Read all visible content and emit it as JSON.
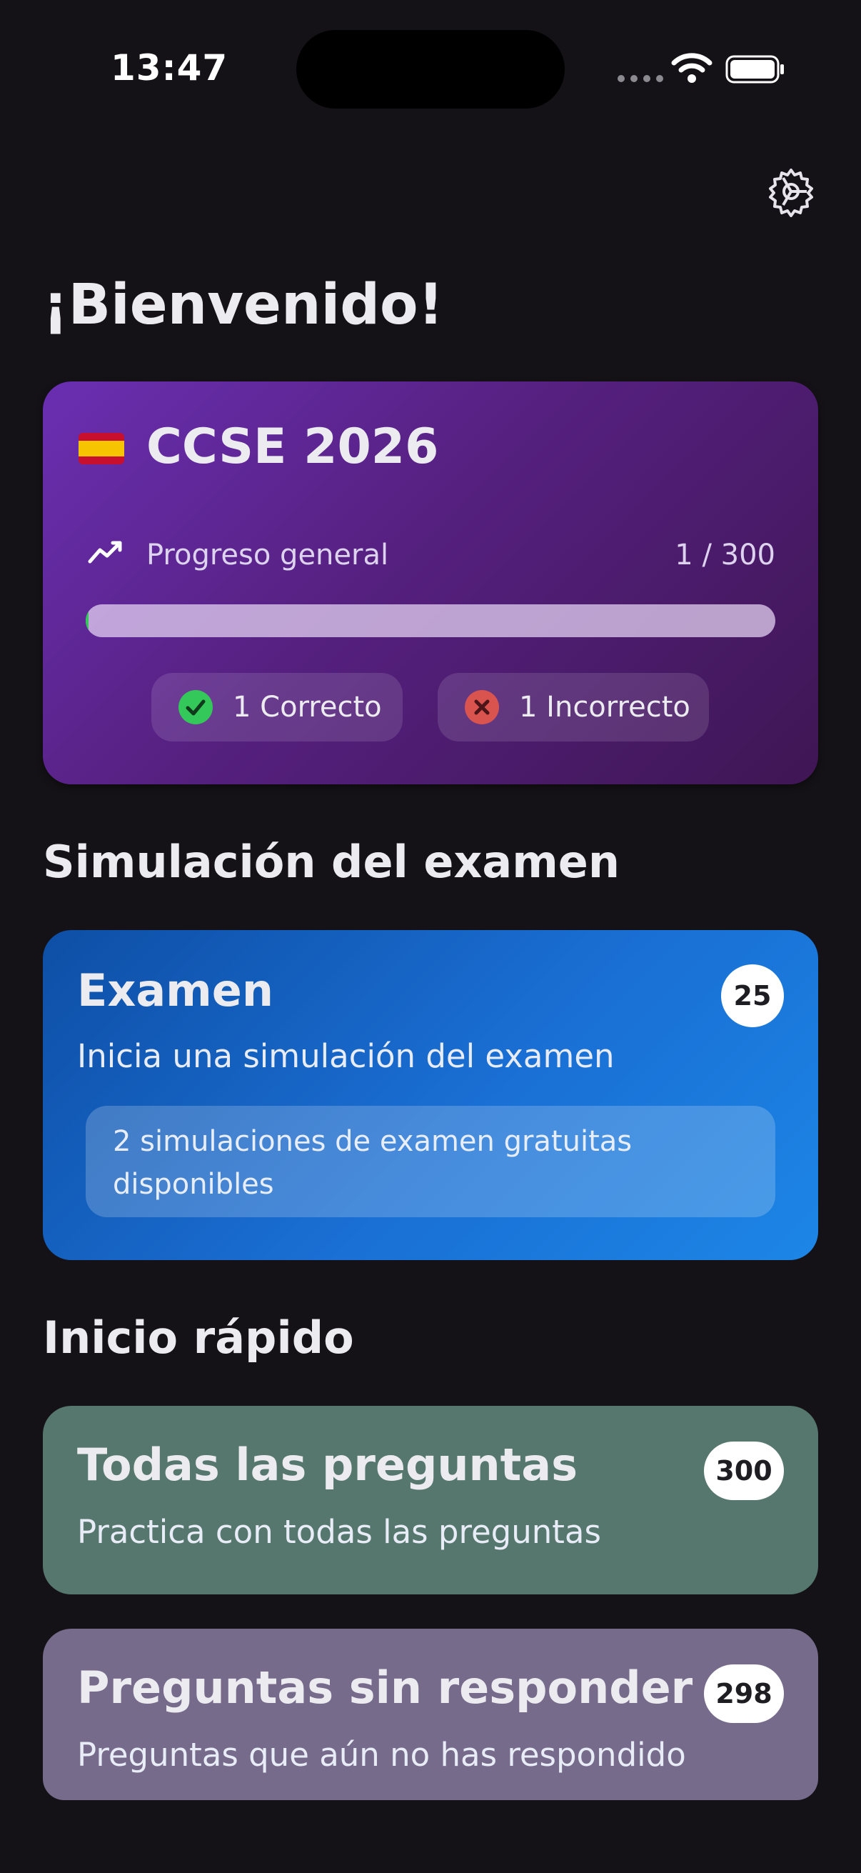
{
  "status_bar": {
    "time": "13:47"
  },
  "header": {
    "welcome": "¡Bienvenido!"
  },
  "progress_card": {
    "title": "CCSE 2026",
    "progress_label": "Progreso general",
    "progress_count": "1 / 300",
    "progress_fraction": 0.0033,
    "correct_label": "1 Correcto",
    "incorrect_label": "1 Incorrecto"
  },
  "exam_section": {
    "title": "Simulación del examen",
    "card": {
      "title": "Examen",
      "badge": "25",
      "subtitle": "Inicia una simulación del examen",
      "free_note": "2 simulaciones de examen gratuitas disponibles"
    }
  },
  "quick_section": {
    "title": "Inicio rápido",
    "cards": [
      {
        "title": "Todas las preguntas",
        "badge": "300",
        "subtitle": "Practica con todas las preguntas",
        "color": "#56776d"
      },
      {
        "title": "Preguntas sin responder",
        "badge": "298",
        "subtitle": "Preguntas que aún no has respondido",
        "color": "#776b8c"
      }
    ]
  },
  "colors": {
    "background": "#141216",
    "progress_card": "#5a2490",
    "exam_card": "#1a6fd4",
    "correct": "#34c759",
    "incorrect": "#d9534f"
  },
  "icons": [
    "settings-gear-icon",
    "spain-flag-icon",
    "trend-chart-icon",
    "check-circle-icon",
    "x-circle-icon",
    "wifi-icon",
    "battery-icon"
  ]
}
